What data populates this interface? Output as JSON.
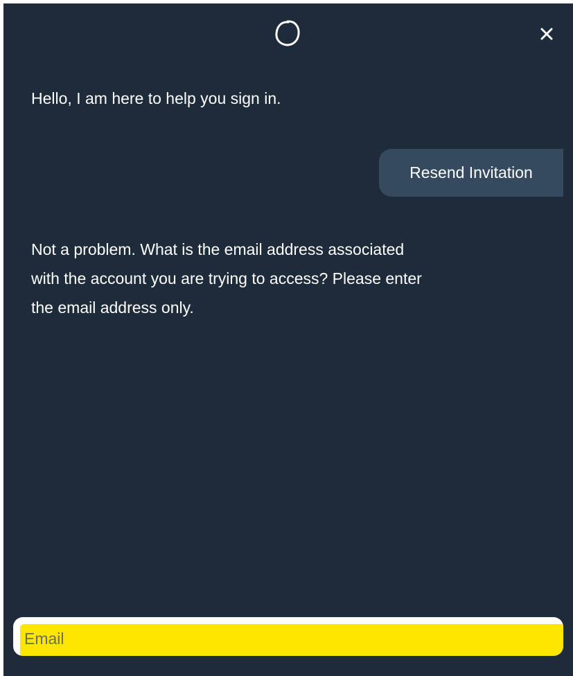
{
  "header": {
    "logo_icon": "circle-logo-icon",
    "close_icon": "close-icon"
  },
  "messages": [
    {
      "from": "bot",
      "text": "Hello, I am here to help you sign in."
    },
    {
      "from": "user",
      "text": "Resend Invitation"
    },
    {
      "from": "bot",
      "text": "Not a problem. What is the email address associated with the account you are trying to access? Please enter the email address only."
    }
  ],
  "input": {
    "placeholder": "Email",
    "value": ""
  },
  "colors": {
    "background": "#1e2b3a",
    "user_bubble": "#354a5f",
    "input_highlight": "#ffe600"
  }
}
